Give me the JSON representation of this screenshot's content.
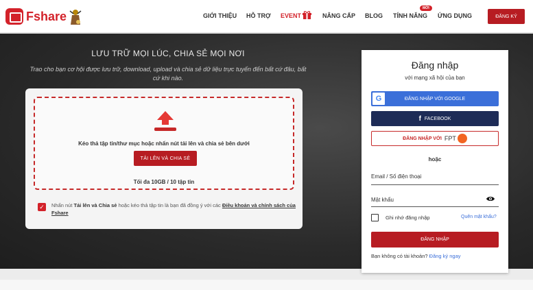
{
  "brand": {
    "name": "Fshare",
    "color": "#d3222a"
  },
  "nav": {
    "items": [
      "GIỚI THIỆU",
      "HỖ TRỢ",
      "EVENT",
      "NÂNG CẤP",
      "BLOG",
      "TÍNH NĂNG",
      "ỨNG DỤNG"
    ],
    "new_badge": "MỚI",
    "signup": "ĐĂNG KÝ"
  },
  "hero": {
    "title": "LƯU TRỮ MỌI LÚC, CHIA SẺ MỌI NƠI",
    "subtitle": "Trao cho bạn cơ hội được lưu trữ, download, upload và chia sẻ dữ liệu trực tuyến đến bất cứ đâu, bất cứ khi nào."
  },
  "upload": {
    "drop_text": "Kéo thả tập tin/thư mục hoặc nhấn nút tải lên và chia sẻ bên dưới",
    "button": "TẢI LÊN VÀ CHIA SẺ",
    "limit": "Tối đa 10GB / 10 tập tin",
    "agree_prefix": "Nhấn nút ",
    "agree_bold": "Tải lên và Chia sẻ",
    "agree_mid": " hoặc kéo thả tập tin là bạn đã đồng ý với các ",
    "agree_link": "Điều khoản và chính sách của Fshare",
    "agree_checked": true
  },
  "login": {
    "title": "Đăng nhập",
    "subtitle": "với mạng xã hội của bạn",
    "google": "ĐĂNG NHẬP VỚI GOOGLE",
    "facebook": "FACEBOOK",
    "fpt_prefix": "ĐĂNG NHẬP VỚI",
    "fpt_brand": "FPT",
    "or": "hoặc",
    "email_label": "Email / Số điện thoại",
    "password_label": "Mật khẩu",
    "remember": "Ghi nhớ đăng nhập",
    "forgot": "Quên mật khẩu?",
    "submit": "ĐĂNG NHẬP",
    "no_account": "Bạn không có tài khoản?",
    "register_now": "Đăng ký ngay"
  }
}
